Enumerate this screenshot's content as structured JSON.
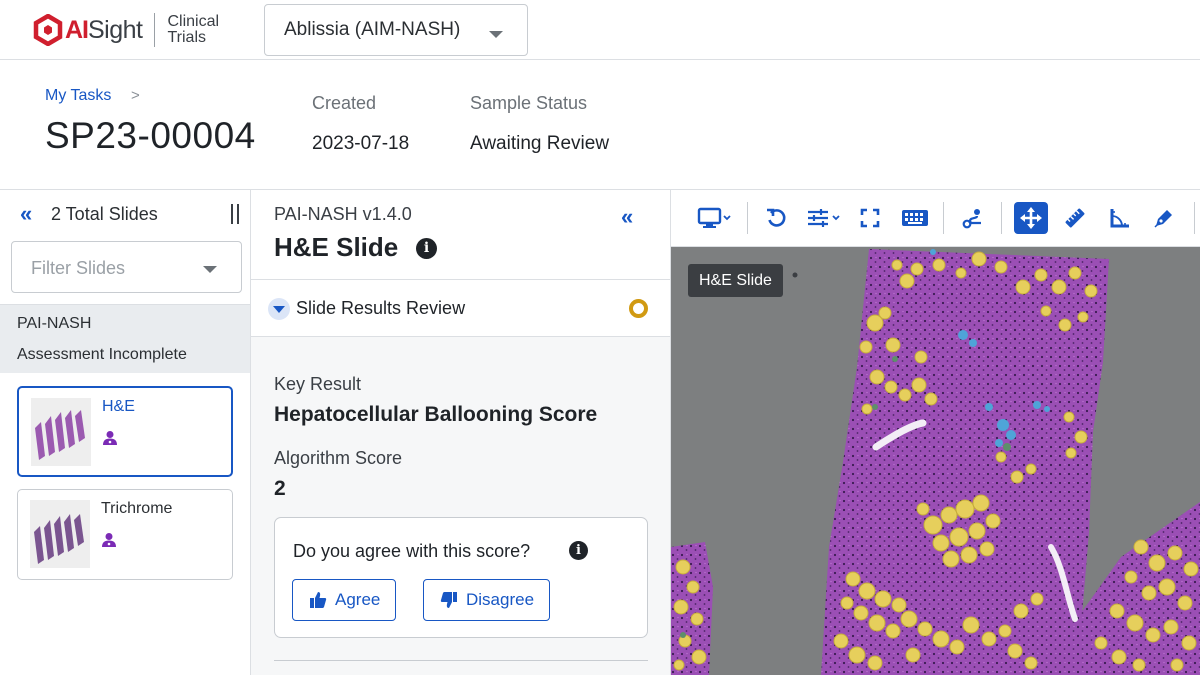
{
  "app": {
    "brand_ai": "AI",
    "brand_sight": "Sight",
    "brand_sub_1": "Clinical",
    "brand_sub_2": "Trials",
    "study_selector": "Ablissia (AIM-NASH)"
  },
  "header": {
    "breadcrumb": "My Tasks",
    "breadcrumb_sep": ">",
    "sample_id": "SP23-00004",
    "created_label": "Created",
    "created_value": "2023-07-18",
    "status_label": "Sample Status",
    "status_value": "Awaiting Review"
  },
  "slides_panel": {
    "title": "2 Total Slides",
    "filter_placeholder": "Filter Slides",
    "group_name": "PAI-NASH",
    "group_status": "Assessment Incomplete",
    "slides": [
      {
        "name": "H&E",
        "selected": true
      },
      {
        "name": "Trichrome",
        "selected": false
      }
    ]
  },
  "results_panel": {
    "algorithm_version": "PAI-NASH v1.4.0",
    "slide_title": "H&E Slide",
    "section_label": "Slide Results Review",
    "key_result_label": "Key Result",
    "key_result_value": "Hepatocellular Ballooning Score",
    "algorithm_score_label": "Algorithm Score",
    "algorithm_score_value": "2",
    "agree_question": "Do you agree with this score?",
    "agree_label": "Agree",
    "disagree_label": "Disagree"
  },
  "viewer": {
    "slide_label": "H&E Slide",
    "tools": [
      "monitor-icon",
      "rotate-icon",
      "adjust-icon",
      "fullscreen-icon",
      "keyboard-icon",
      "route-icon",
      "move-icon",
      "ruler-icon",
      "angle-icon",
      "pen-icon"
    ],
    "active_tool": "move-icon"
  },
  "colors": {
    "accent": "#1857c4",
    "brand_red": "#d01f2e",
    "pending": "#d19a12",
    "tissue_purple": "#9b4fb5",
    "fat_yellow": "#e6cf5c",
    "viewer_background": "#7d7f80"
  }
}
